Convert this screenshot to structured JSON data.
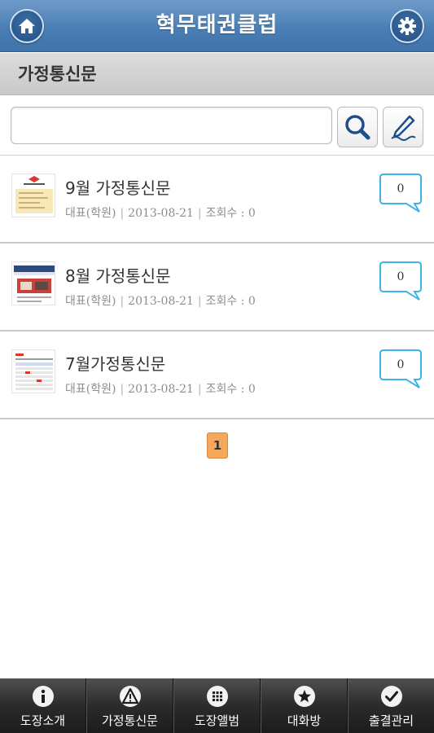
{
  "header": {
    "title": "혁무태권클럽",
    "home_icon": "home-icon",
    "settings_icon": "gear-icon",
    "accent": "#4a7fb5"
  },
  "section": {
    "title": "가정통신문"
  },
  "search": {
    "value": "",
    "placeholder": "",
    "search_icon": "search-icon",
    "write_icon": "pen-icon"
  },
  "posts": [
    {
      "title": "9월 가정통신문",
      "author": "대표(학원)",
      "date": "2013-08-21",
      "views_label": "조회수 : 0",
      "comments": "0"
    },
    {
      "title": "8월 가정통신문",
      "author": "대표(학원)",
      "date": "2013-08-21",
      "views_label": "조회수 : 0",
      "comments": "0"
    },
    {
      "title": "7월가정통신문",
      "author": "대표(학원)",
      "date": "2013-08-21",
      "views_label": "조회수 : 0",
      "comments": "0"
    }
  ],
  "pagination": {
    "current": "1",
    "accent": "#f5a85a"
  },
  "tabbar": {
    "tabs": [
      {
        "label": "도장소개",
        "icon": "info-icon"
      },
      {
        "label": "가정통신문",
        "icon": "warning-icon"
      },
      {
        "label": "도장앨범",
        "icon": "grid-icon"
      },
      {
        "label": "대화방",
        "icon": "star-icon"
      },
      {
        "label": "출결관리",
        "icon": "check-icon"
      }
    ]
  }
}
